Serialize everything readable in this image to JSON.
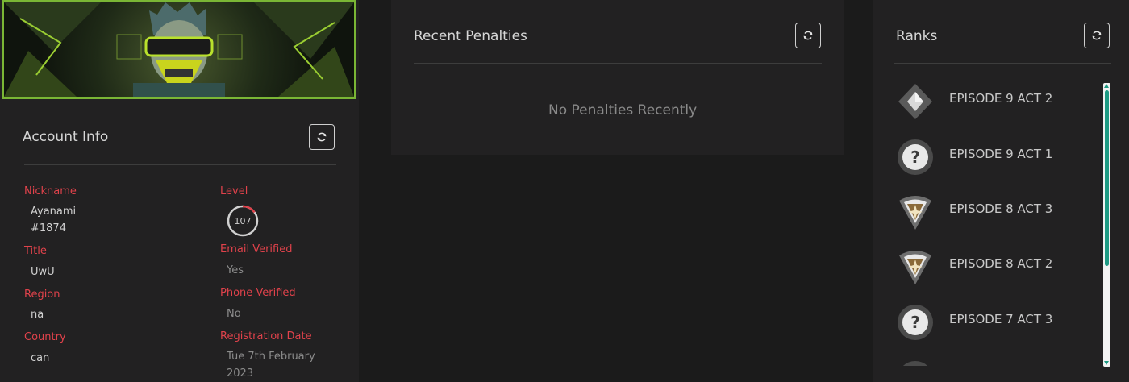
{
  "account": {
    "title": "Account Info",
    "fields_left": [
      {
        "label": "Nickname",
        "value": "Ayanami\n#1874"
      },
      {
        "label": "Title",
        "value": "UwU"
      },
      {
        "label": "Region",
        "value": "na"
      },
      {
        "label": "Country",
        "value": "can"
      }
    ],
    "level": {
      "label": "Level",
      "value": "107",
      "progress": 0.15
    },
    "fields_right": [
      {
        "label": "Email Verified",
        "value": "Yes"
      },
      {
        "label": "Phone Verified",
        "value": "No"
      },
      {
        "label": "Registration Date",
        "value": "Tue 7th February\n2023"
      }
    ]
  },
  "penalties": {
    "title": "Recent Penalties",
    "empty_message": "No Penalties Recently"
  },
  "ranks": {
    "title": "Ranks",
    "items": [
      {
        "label": "EPISODE 9 ACT 2",
        "icon": "diamond-rank-icon"
      },
      {
        "label": "EPISODE 9 ACT 1",
        "icon": "unranked-icon"
      },
      {
        "label": "EPISODE 8 ACT 3",
        "icon": "ascendant-rank-icon"
      },
      {
        "label": "EPISODE 8 ACT 2",
        "icon": "ascendant-rank-icon"
      },
      {
        "label": "EPISODE 7 ACT 3",
        "icon": "unranked-icon"
      }
    ]
  },
  "colors": {
    "accent_red": "#e0424b",
    "banner_border": "#7ab635",
    "scroll_thumb": "#1e9a83"
  }
}
